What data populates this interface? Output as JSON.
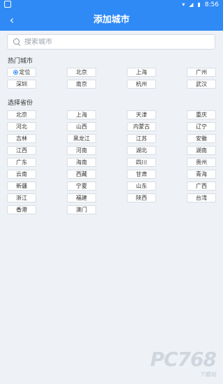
{
  "status_bar": {
    "time": "8:56"
  },
  "app_bar": {
    "title": "添加城市"
  },
  "search": {
    "placeholder": "搜索城市"
  },
  "hot": {
    "label": "热门城市",
    "locate": "定位",
    "cities": [
      "北京",
      "上海",
      "广州",
      "深圳",
      "南京",
      "杭州",
      "武汉"
    ]
  },
  "provinces": {
    "label": "选择省份",
    "items": [
      "北京",
      "上海",
      "天津",
      "重庆",
      "河北",
      "山西",
      "内蒙古",
      "辽宁",
      "吉林",
      "黑龙江",
      "江苏",
      "安徽",
      "江西",
      "河南",
      "湖北",
      "湖南",
      "广东",
      "海南",
      "四川",
      "贵州",
      "云南",
      "西藏",
      "甘肃",
      "青海",
      "新疆",
      "宁夏",
      "山东",
      "广西",
      "浙江",
      "福建",
      "陕西",
      "台湾",
      "香港",
      "澳门"
    ]
  },
  "watermark": {
    "text": "PC768",
    "sub": "下载站"
  }
}
